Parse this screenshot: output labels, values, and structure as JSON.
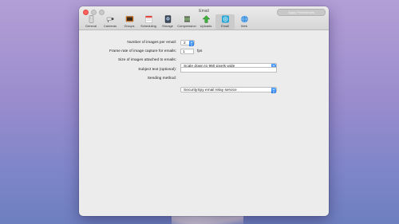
{
  "window": {
    "title": "Email",
    "apply_label": "Apply Preferences"
  },
  "toolbar": {
    "items": [
      {
        "label": "General",
        "icon": "general-icon"
      },
      {
        "label": "Cameras",
        "icon": "cameras-icon"
      },
      {
        "label": "Groups",
        "icon": "groups-icon"
      },
      {
        "label": "Scheduling",
        "icon": "scheduling-icon"
      },
      {
        "label": "Storage",
        "icon": "storage-icon"
      },
      {
        "label": "Compression",
        "icon": "compression-icon"
      },
      {
        "label": "Uploads",
        "icon": "uploads-icon"
      },
      {
        "label": "Email",
        "icon": "email-icon",
        "selected": true
      },
      {
        "label": "Web",
        "icon": "web-icon"
      }
    ]
  },
  "form": {
    "num_images_label": "Number of images per email:",
    "num_images_value": "2",
    "frame_rate_label": "Frame rate of image capture for emails:",
    "frame_rate_value": "1",
    "frame_rate_unit": "fps",
    "size_label": "Size of images attached to emails:",
    "size_value": "Scale down to 960 pixels wide",
    "subject_label": "Subject text (optional):",
    "subject_value": "",
    "method_label": "Sending method:",
    "method_value": "SecuritySpy email relay service"
  },
  "colors": {
    "accent": "#1b74e8",
    "close": "#fc615d"
  }
}
